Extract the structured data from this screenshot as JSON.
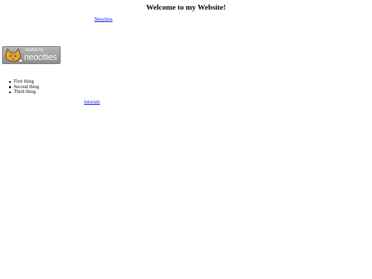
{
  "header": {
    "title": "Welcome to my Website!",
    "neocities_link": "Neocities"
  },
  "badge": {
    "icon": "neocities-cat-logo",
    "small_text": "hosted by",
    "brand_text": "neocities",
    "colors": {
      "background": "#a3a3a3",
      "text": "#ffffff",
      "cat": "#f4a623"
    }
  },
  "list": {
    "items": [
      {
        "label": "First thing"
      },
      {
        "label": "Second thing"
      },
      {
        "label": "Third thing"
      }
    ]
  },
  "footer": {
    "tutorials_link": "tutorials"
  },
  "colors": {
    "link": "#0000ee",
    "text": "#000000",
    "background": "#ffffff"
  }
}
